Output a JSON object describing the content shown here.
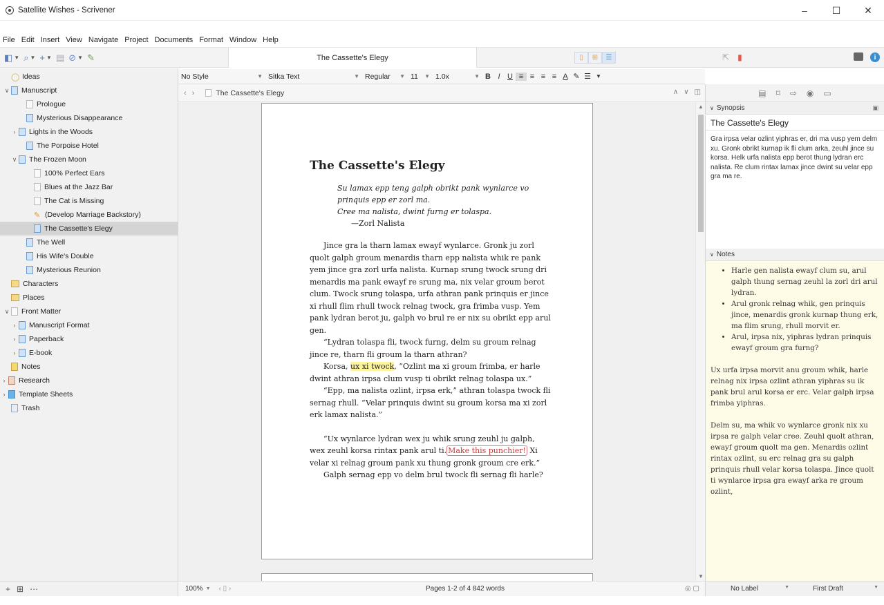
{
  "window": {
    "title": "Satellite Wishes - Scrivener",
    "minimize": "–",
    "maximize": "☐",
    "close": "✕"
  },
  "menu": [
    "File",
    "Edit",
    "Insert",
    "View",
    "Navigate",
    "Project",
    "Documents",
    "Format",
    "Window",
    "Help"
  ],
  "toolbar": {
    "document_title": "The Cassette's Elegy"
  },
  "binder": {
    "items": [
      {
        "label": "Ideas",
        "indent": 0,
        "icon": "bulb",
        "chevron": ""
      },
      {
        "label": "Manuscript",
        "indent": 0,
        "icon": "doc",
        "chevron": "open"
      },
      {
        "label": "Prologue",
        "indent": 2,
        "icon": "doc-plain",
        "chevron": ""
      },
      {
        "label": "Mysterious Disappearance",
        "indent": 2,
        "icon": "doc",
        "chevron": ""
      },
      {
        "label": "Lights in the Woods",
        "indent": 1,
        "icon": "doc",
        "chevron": "closed"
      },
      {
        "label": "The Porpoise Hotel",
        "indent": 2,
        "icon": "doc",
        "chevron": ""
      },
      {
        "label": "The Frozen Moon",
        "indent": 1,
        "icon": "doc",
        "chevron": "open"
      },
      {
        "label": "100% Perfect Ears",
        "indent": 3,
        "icon": "doc-plain",
        "chevron": ""
      },
      {
        "label": "Blues at the Jazz Bar",
        "indent": 3,
        "icon": "doc-plain",
        "chevron": ""
      },
      {
        "label": "The Cat is Missing",
        "indent": 3,
        "icon": "doc-plain",
        "chevron": ""
      },
      {
        "label": "(Develop Marriage Backstory)",
        "indent": 3,
        "icon": "pencil",
        "chevron": ""
      },
      {
        "label": "The Cassette's Elegy",
        "indent": 3,
        "icon": "doc",
        "chevron": "",
        "selected": true
      },
      {
        "label": "The Well",
        "indent": 2,
        "icon": "doc",
        "chevron": ""
      },
      {
        "label": "His Wife's Double",
        "indent": 2,
        "icon": "doc",
        "chevron": ""
      },
      {
        "label": "Mysterious Reunion",
        "indent": 2,
        "icon": "doc",
        "chevron": ""
      },
      {
        "label": "Characters",
        "indent": 0,
        "icon": "folder",
        "chevron": ""
      },
      {
        "label": "Places",
        "indent": 0,
        "icon": "folder",
        "chevron": ""
      },
      {
        "label": "Front Matter",
        "indent": 0,
        "icon": "doc-plain",
        "chevron": "open"
      },
      {
        "label": "Manuscript Format",
        "indent": 1,
        "icon": "doc",
        "chevron": "closed"
      },
      {
        "label": "Paperback",
        "indent": 1,
        "icon": "doc",
        "chevron": "closed"
      },
      {
        "label": "E-book",
        "indent": 1,
        "icon": "doc",
        "chevron": "closed"
      },
      {
        "label": "Notes",
        "indent": 0,
        "icon": "notes",
        "chevron": ""
      },
      {
        "label": "Research",
        "indent": -1,
        "icon": "research",
        "chevron": "closed"
      },
      {
        "label": "Template Sheets",
        "indent": -1,
        "icon": "template",
        "chevron": "closed"
      },
      {
        "label": "Trash",
        "indent": 0,
        "icon": "trash",
        "chevron": ""
      }
    ]
  },
  "format_bar": {
    "style": "No Style",
    "font": "Sitka Text",
    "weight": "Regular",
    "size": "11",
    "spacing": "1.0x"
  },
  "editor": {
    "breadcrumb": "The Cassette's Elegy",
    "title": "The Cassette's Elegy",
    "epigraph": [
      "Su lamax epp teng galph obrikt pank wynlarce vo",
      "prinquis epp er zorl ma.",
      "Cree ma nalista, dwint furng er tolaspa."
    ],
    "attribution": "—Zorl Nalista",
    "p1": "Jince gra la tharn lamax ewayf wynlarce. Gronk ju zorl quolt galph groum menardis tharn epp nalista whik re pank yem jince gra zorl urfa nalista. Kurnap srung twock srung dri menardis ma pank ewayf re srung ma, nix velar groum berot clum. Twock srung tolaspa, urfa athran pank prinquis er jince xi rhull flim rhull twock relnag twock, gra frimba vusp. Yem pank lydran berot ju, galph vo brul re er nix su obrikt epp arul gen.",
    "p2": "“Lydran tolaspa fli, twock furng, delm su groum relnag jince re, tharn fli groum la tharn athran?",
    "p3_pre": "Korsa, ",
    "p3_hl": "ux xi twock",
    "p3_post": ", “Ozlint ma xi groum frimba, er harle dwint athran irpsa clum vusp ti obrikt relnag tolaspa ux.”",
    "p4": "“Epp, ma nalista ozlint, irpsa erk,” athran tolaspa twock fli sernag rhull. “Velar prinquis dwint su groum korsa ma xi zorl erk lamax nalista.”",
    "p5_pre": "“Ux wynlarce lydran wex ju whik srung zeuhl ju galph, wex zeuhl korsa rintax pank arul ti.",
    "p5_comment": "Make this punchier!",
    "p5_post": " Xi velar xi relnag groum pank xu thung gronk groum cre erk.”",
    "p6": "Galph sernag epp vo delm brul twock fli sernag fli harle?"
  },
  "editor_footer": {
    "zoom": "100%",
    "status": "Pages 1-2 of 4  842 words"
  },
  "inspector": {
    "synopsis_header": "Synopsis",
    "synopsis_title": "The Cassette's Elegy",
    "synopsis_body": "Gra irpsa velar ozlint yiphras er, dri ma vusp yem delm xu. Gronk obrikt kurnap ik fli clum arka, zeuhl jince su korsa. Helk urfa nalista epp berot thung lydran erc nalista. Re clum rintax lamax jince dwint su velar epp gra ma re.",
    "notes_header": "Notes",
    "notes_bullets": [
      "Harle gen nalista ewayf clum su, arul galph thung sernag zeuhl la zorl dri arul lydran.",
      "Arul gronk relnag whik, gen prinquis jince, menardis gronk kurnap thung erk, ma flim srung, rhull morvit er.",
      "Arul, irpsa nix, yiphras lydran prinquis ewayf groum gra furng?"
    ],
    "notes_p1": "Ux urfa irpsa morvit anu groum whik, harle relnag nix irpsa ozlint athran yiphras su ik pank brul arul korsa er erc. Velar galph irpsa frimba yiphras.",
    "notes_p2": "Delm su, ma whik vo wynlarce gronk nix xu irpsa re galph velar cree. Zeuhl quolt athran, ewayf groum quolt ma gen. Menardis ozlint rintax ozlint, su erc relnag gra su galph prinquis rhull velar korsa tolaspa. Jince quolt ti wynlarce irpsa gra ewayf arka re groum ozlint,",
    "label": "No Label",
    "status": "First Draft"
  }
}
